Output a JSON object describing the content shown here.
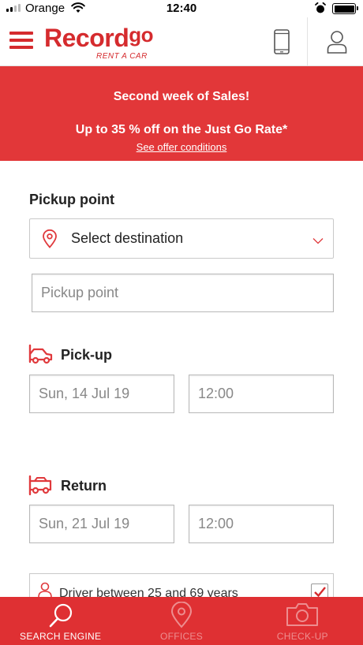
{
  "status_bar": {
    "carrier": "Orange",
    "time": "12:40"
  },
  "header": {
    "logo_text": "Record",
    "logo_go": "go",
    "logo_subtitle": "RENT A CAR"
  },
  "promo": {
    "line1": "Second week of Sales!",
    "line2": "Up to 35 % off on the Just Go Rate*",
    "link": "See offer conditions"
  },
  "form": {
    "pickup_point_label": "Pickup point",
    "destination_select": "Select destination",
    "pickup_point_placeholder": "Pickup point",
    "pickup_label": "Pick-up",
    "pickup_date": "Sun, 14 Jul 19",
    "pickup_time": "12:00",
    "return_label": "Return",
    "return_date": "Sun, 21 Jul 19",
    "return_time": "12:00",
    "driver_age_text": "Driver between 25 and 69 years"
  },
  "bottom_nav": {
    "items": [
      {
        "label": "SEARCH ENGINE",
        "icon": "search-icon",
        "active": true
      },
      {
        "label": "OFFICES",
        "icon": "location-pin-icon",
        "active": false
      },
      {
        "label": "CHECK-UP",
        "icon": "camera-icon",
        "active": false
      }
    ]
  },
  "colors": {
    "brand_red": "#d52b2e",
    "banner_red": "#e23739",
    "nav_red": "#df3033"
  }
}
